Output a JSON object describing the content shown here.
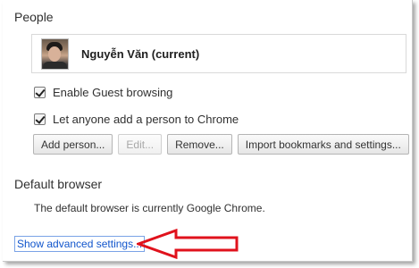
{
  "people": {
    "title": "People",
    "profile": {
      "name": "Nguyễn Văn (current)",
      "avatar": "user-photo"
    },
    "options": [
      {
        "label": "Enable Guest browsing",
        "checked": true
      },
      {
        "label": "Let anyone add a person to Chrome",
        "checked": true
      }
    ],
    "buttons": {
      "add_person": "Add person...",
      "edit": "Edit...",
      "remove": "Remove...",
      "import": "Import bookmarks and settings..."
    }
  },
  "default_browser": {
    "title": "Default browser",
    "status": "The default browser is currently Google Chrome."
  },
  "advanced_link": "Show advanced settings...",
  "colors": {
    "link": "#1155cc",
    "annotation_arrow": "#e0121c"
  },
  "icons": [
    "checkbox-checked-icon",
    "annotation-arrow-icon"
  ]
}
